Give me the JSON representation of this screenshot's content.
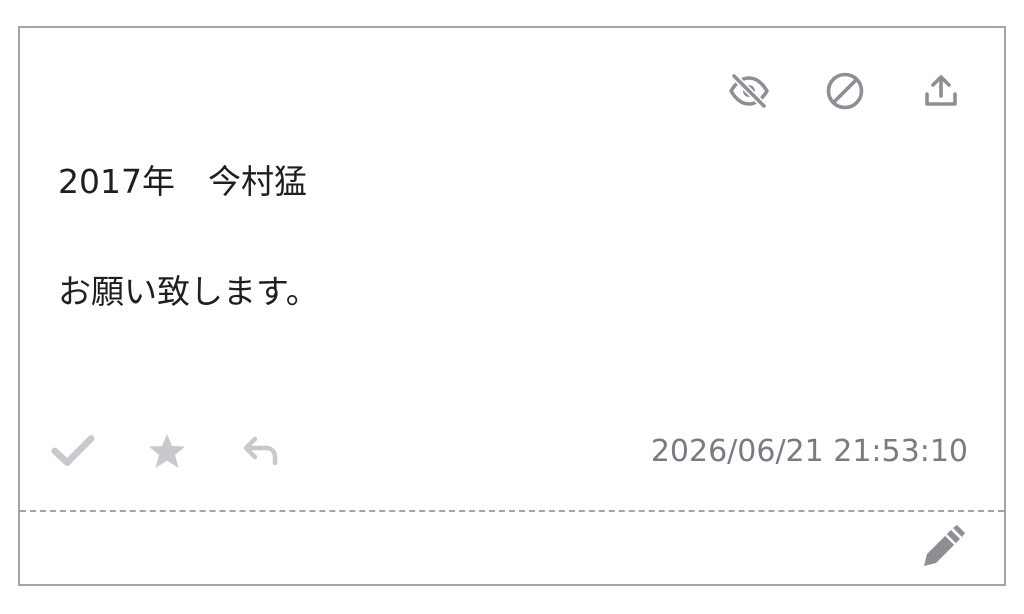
{
  "post": {
    "title_line": "2017年　今村猛",
    "body_line": "お願い致します。",
    "timestamp": "2026/06/21 21:53:10"
  },
  "icons": {
    "top_actions": [
      "eye-slash-icon",
      "ban-icon",
      "upload-icon"
    ],
    "reactions": [
      "check-icon",
      "star-icon",
      "reply-icon"
    ],
    "edit": "pencil-icon"
  },
  "colors": {
    "border": "#a3a3ab",
    "top_icon": "#8e8e96",
    "reaction_icon": "#c8c8cf",
    "timestamp": "#7a7a84",
    "text": "#1f1f1f"
  }
}
